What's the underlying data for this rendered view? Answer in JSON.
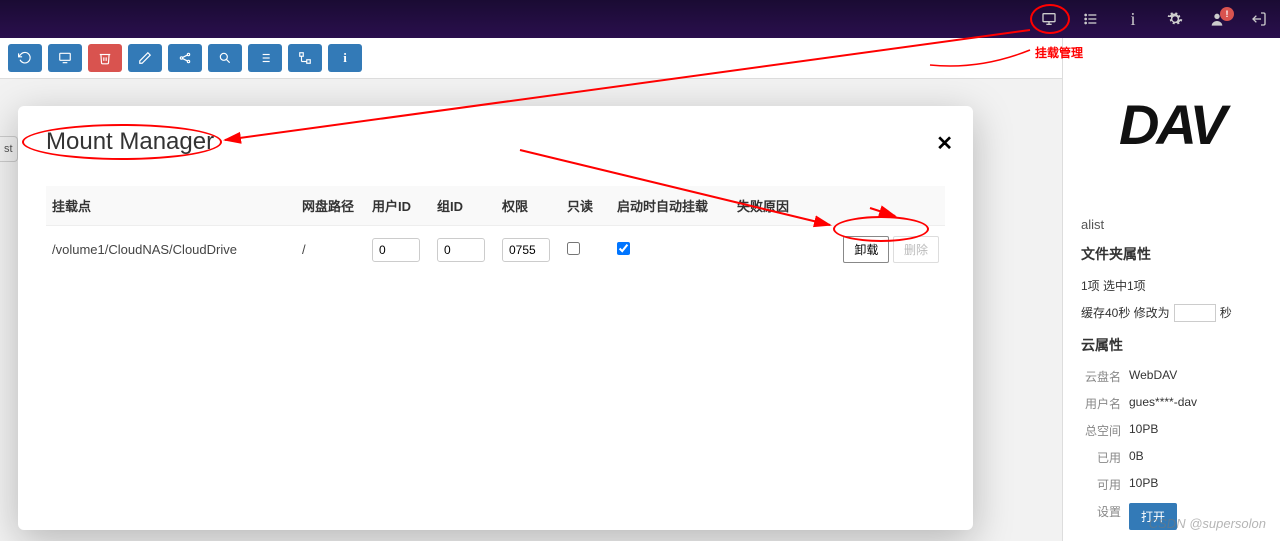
{
  "topbar": {
    "badge": "!"
  },
  "toolbar_left_tab": "st",
  "modal": {
    "title": "Mount Manager",
    "headers": {
      "mount": "挂载点",
      "diskpath": "网盘路径",
      "uid": "用户ID",
      "gid": "组ID",
      "perm": "权限",
      "readonly": "只读",
      "automount": "启动时自动挂载",
      "failreason": "失败原因"
    },
    "row": {
      "mount": "/volume1/CloudNAS/CloudDrive",
      "diskpath": "/",
      "uid": "0",
      "gid": "0",
      "perm": "0755",
      "readonly": false,
      "automount": true,
      "btn_unmount": "卸载",
      "btn_delete": "删除"
    }
  },
  "sidebar": {
    "logo": "DAV",
    "name": "alist",
    "h_folder": "文件夹属性",
    "sel": "1项 选中1项",
    "cache_pre": "缓存40秒 修改为",
    "cache_suf": "秒",
    "h_cloud": "云属性",
    "rows": {
      "disk_l": "云盘名",
      "disk_v": "WebDAV",
      "user_l": "用户名",
      "user_v": "gues****-dav",
      "total_l": "总空间",
      "total_v": "10PB",
      "used_l": "已用",
      "used_v": "0B",
      "avail_l": "可用",
      "avail_v": "10PB",
      "set_l": "设置",
      "open": "打开"
    }
  },
  "anno": {
    "top_label": "挂载管理"
  },
  "watermark": "CSDN @supersolon"
}
